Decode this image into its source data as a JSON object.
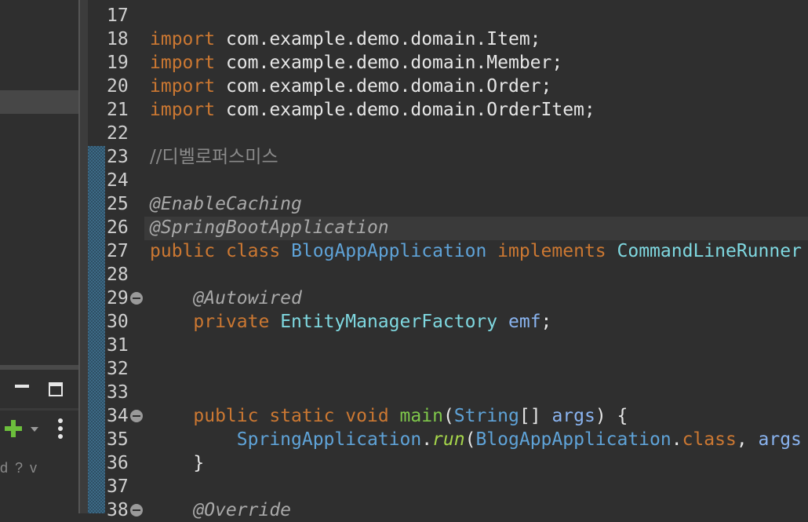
{
  "left_panel": {
    "filter_text": "d ? v",
    "icons": [
      "minimize-icon",
      "maximize-icon",
      "add-icon",
      "dropdown-icon",
      "kebab-icon"
    ]
  },
  "editor": {
    "colors": {
      "background": "#2f2f2f",
      "keyword": "#cc7832",
      "type": "#5fa3d8",
      "annotation": "#a9a9a9",
      "method": "#7fc84b",
      "change_bar": "#3d6a86"
    },
    "lines": [
      {
        "n": "17",
        "tokens": []
      },
      {
        "n": "18",
        "tokens": [
          {
            "t": "import",
            "c": "kw"
          },
          {
            "t": " com.example.demo.domain.Item;",
            "c": ""
          }
        ]
      },
      {
        "n": "19",
        "tokens": [
          {
            "t": "import",
            "c": "kw"
          },
          {
            "t": " com.example.demo.domain.Member;",
            "c": ""
          }
        ]
      },
      {
        "n": "20",
        "tokens": [
          {
            "t": "import",
            "c": "kw"
          },
          {
            "t": " com.example.demo.domain.Order;",
            "c": ""
          }
        ]
      },
      {
        "n": "21",
        "tokens": [
          {
            "t": "import",
            "c": "kw"
          },
          {
            "t": " com.example.demo.domain.OrderItem;",
            "c": ""
          }
        ]
      },
      {
        "n": "22",
        "tokens": []
      },
      {
        "n": "23",
        "tokens": [
          {
            "t": "//디벨로퍼스미스",
            "c": "cmt"
          }
        ]
      },
      {
        "n": "24",
        "tokens": []
      },
      {
        "n": "25",
        "tokens": [
          {
            "t": "@EnableCaching",
            "c": "ann"
          }
        ]
      },
      {
        "n": "26",
        "tokens": [
          {
            "t": "@SpringBootApplication",
            "c": "ann"
          }
        ],
        "current": true
      },
      {
        "n": "27",
        "tokens": [
          {
            "t": "public",
            "c": "kw"
          },
          {
            "t": " ",
            "c": ""
          },
          {
            "t": "class",
            "c": "kw"
          },
          {
            "t": " ",
            "c": ""
          },
          {
            "t": "BlogAppApplication",
            "c": "typ"
          },
          {
            "t": " ",
            "c": ""
          },
          {
            "t": "implements",
            "c": "kw"
          },
          {
            "t": " ",
            "c": ""
          },
          {
            "t": "CommandLineRunner",
            "c": "typ2"
          }
        ]
      },
      {
        "n": "28",
        "tokens": []
      },
      {
        "n": "29",
        "fold": true,
        "tokens": [
          {
            "t": "    ",
            "c": ""
          },
          {
            "t": "@Autowired",
            "c": "ann"
          }
        ]
      },
      {
        "n": "30",
        "tokens": [
          {
            "t": "    ",
            "c": ""
          },
          {
            "t": "private",
            "c": "kw"
          },
          {
            "t": " ",
            "c": ""
          },
          {
            "t": "EntityManagerFactory",
            "c": "typ2"
          },
          {
            "t": " ",
            "c": ""
          },
          {
            "t": "emf",
            "c": "fld"
          },
          {
            "t": ";",
            "c": ""
          }
        ]
      },
      {
        "n": "31",
        "tokens": []
      },
      {
        "n": "32",
        "tokens": []
      },
      {
        "n": "33",
        "tokens": []
      },
      {
        "n": "34",
        "fold": true,
        "tokens": [
          {
            "t": "    ",
            "c": ""
          },
          {
            "t": "public",
            "c": "kw"
          },
          {
            "t": " ",
            "c": ""
          },
          {
            "t": "static",
            "c": "kw"
          },
          {
            "t": " ",
            "c": ""
          },
          {
            "t": "void",
            "c": "kw"
          },
          {
            "t": " ",
            "c": ""
          },
          {
            "t": "main",
            "c": "mth"
          },
          {
            "t": "(",
            "c": ""
          },
          {
            "t": "String",
            "c": "typ"
          },
          {
            "t": "[] ",
            "c": ""
          },
          {
            "t": "args",
            "c": "fld"
          },
          {
            "t": ") {",
            "c": ""
          }
        ]
      },
      {
        "n": "35",
        "tokens": [
          {
            "t": "        ",
            "c": ""
          },
          {
            "t": "SpringApplication",
            "c": "typ"
          },
          {
            "t": ".",
            "c": ""
          },
          {
            "t": "run",
            "c": "run"
          },
          {
            "t": "(",
            "c": ""
          },
          {
            "t": "BlogAppApplication",
            "c": "typ"
          },
          {
            "t": ".",
            "c": ""
          },
          {
            "t": "class",
            "c": "kw"
          },
          {
            "t": ", ",
            "c": ""
          },
          {
            "t": "args",
            "c": "fld"
          }
        ]
      },
      {
        "n": "36",
        "tokens": [
          {
            "t": "    }",
            "c": ""
          }
        ]
      },
      {
        "n": "37",
        "tokens": []
      },
      {
        "n": "38",
        "fold": true,
        "tokens": [
          {
            "t": "    ",
            "c": ""
          },
          {
            "t": "@Override",
            "c": "ann"
          }
        ]
      }
    ]
  }
}
